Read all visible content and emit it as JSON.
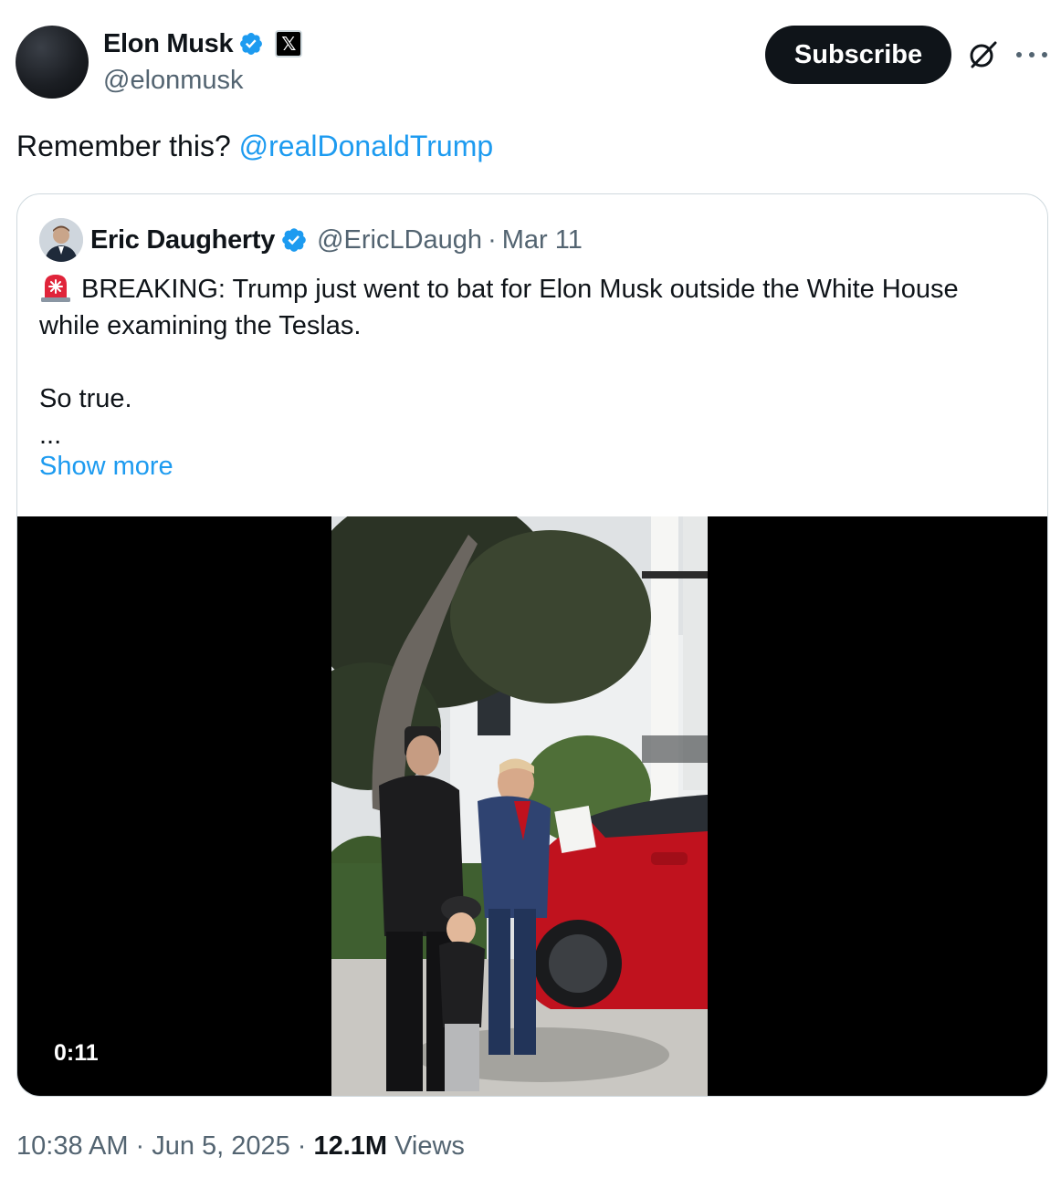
{
  "author": {
    "display_name": "Elon Musk",
    "handle": "@elonmusk",
    "affiliate_badge": "𝕏"
  },
  "actions": {
    "subscribe_label": "Subscribe"
  },
  "tweet": {
    "text": "Remember this? ",
    "mention": "@realDonaldTrump"
  },
  "quote": {
    "display_name": "Eric Daugherty",
    "handle": "@EricLDaugh",
    "separator": "·",
    "date": "Mar 11",
    "line1": "BREAKING: Trump just went to bat for Elon Musk outside the White House",
    "line2": "while examining the Teslas.",
    "line3": "So true.",
    "ellipsis": "...",
    "show_more": "Show more",
    "video_duration": "0:11"
  },
  "meta": {
    "time": "10:38 AM",
    "date": "Jun 5, 2025",
    "separator": "·",
    "views_count": "12.1M",
    "views_label": "Views"
  },
  "colors": {
    "accent": "#1d9bf0",
    "text_primary": "#0f1419",
    "text_secondary": "#536471",
    "border": "#cfd9de"
  },
  "icons": [
    "verified-badge-icon",
    "x-affiliate-icon",
    "grok-icon",
    "more-options-icon",
    "siren-emoji-icon"
  ]
}
